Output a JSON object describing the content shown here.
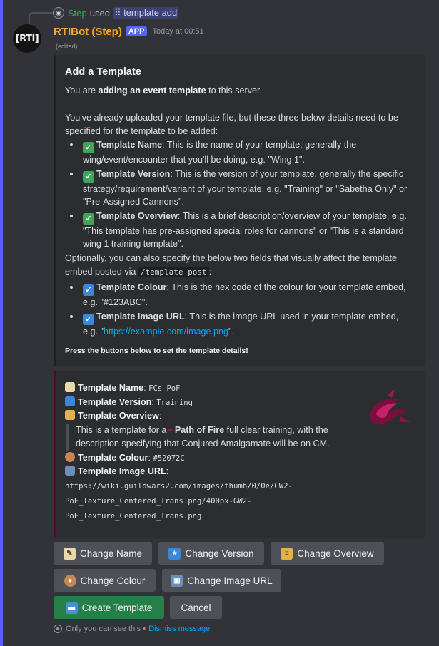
{
  "reply": {
    "user": "Step",
    "action": "used",
    "command": "template add",
    "command_icon": "slash-command-icon"
  },
  "message": {
    "avatar_text": "[RTI]",
    "author": "RTIBot (Step)",
    "badge": "APP",
    "timestamp": "Today at 00:51",
    "edited": "(edited)"
  },
  "embed_main": {
    "title": "Add a Template",
    "intro_prefix": "You are ",
    "intro_bold": "adding an event template",
    "intro_suffix": " to this server.",
    "para2": "You've already uploaded your template file, but these three below details need to be specified for the template to be added:",
    "required_items": [
      {
        "label": "Template Name",
        "text": ": This is the name of your template, generally the wing/event/encounter that you'll be doing, e.g. \"Wing 1\"."
      },
      {
        "label": "Template Version",
        "text": ": This is the version of your template, generally the specific strategy/requirement/variant of your template, e.g. \"Training\" or \"Sabetha Only\" or \"Pre-Assigned Cannons\"."
      },
      {
        "label": "Template Overview",
        "text": ": This is a brief description/overview of your template, e.g. \"This template has pre-assigned special roles for cannons\" or \"This is a standard wing 1 training template\"."
      }
    ],
    "optional_prefix": "Optionally, you can also specify the below two fields that visually affect the template embed posted via ",
    "optional_code": "/template post",
    "optional_suffix": ":",
    "optional_items": [
      {
        "label": "Template Colour",
        "text": ": This is the hex code of the colour for your template embed, e.g. \"#123ABC\"."
      },
      {
        "label": "Template Image URL",
        "text": ": This is the image URL used in your template embed, e.g. \"",
        "link": "https://example.com/image.png",
        "text_after": "\"."
      }
    ],
    "footer": "Press the buttons below to set the template details!",
    "border_color": "#1e1f22"
  },
  "embed_preview": {
    "name_label": "Template Name",
    "name_value": "FCs PoF",
    "version_label": "Template Version",
    "version_value": "Training",
    "overview_label": "Template Overview",
    "overview_prefix": "This is a template for a",
    "overview_bold": "Path of Fire",
    "overview_suffix": " full clear training, with the description specifying that Conjured Amalgamate will be on CM.",
    "colour_label": "Template Colour",
    "colour_value": "#52072C",
    "image_label": "Template Image URL",
    "image_value": "https://wiki.guildwars2.com/images/thumb/0/0e/GW2-PoF_Texture_Centered_Trans.png/400px-GW2-PoF_Texture_Centered_Trans.png",
    "border_color": "#52072c",
    "icons": [
      "memo-icon",
      "input-numbers-icon",
      "scroll-icon",
      "palette-icon",
      "framed-picture-icon"
    ]
  },
  "buttons": {
    "change_name": "Change Name",
    "change_version": "Change Version",
    "change_overview": "Change Overview",
    "change_colour": "Change Colour",
    "change_image": "Change Image URL",
    "create": "Create Template",
    "cancel": "Cancel"
  },
  "ephemeral": {
    "note": "Only you can see this •",
    "dismiss": "Dismiss message"
  },
  "colors": {
    "background": "#323339",
    "embed_bg": "#2b2d31",
    "author": "#f9a62b",
    "app_badge": "#5865f2",
    "primary_button": "#248046",
    "secondary_button": "#4e5058",
    "link": "#00a8fc"
  }
}
